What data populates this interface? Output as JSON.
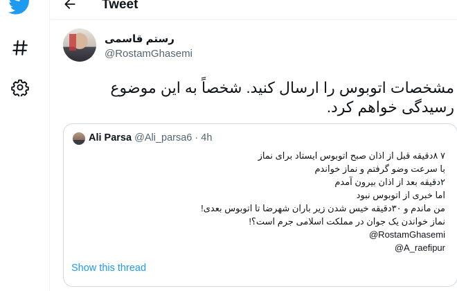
{
  "colors": {
    "brand": "#1d9bf0",
    "text": "#0f1419",
    "secondary": "#536471",
    "border": "#cfd9de"
  },
  "nav": {
    "icons": [
      "twitter-bird-icon",
      "hashtag-icon",
      "gear-icon"
    ]
  },
  "header": {
    "title": "Tweet"
  },
  "tweet": {
    "author_name": "رستم قاسمی",
    "author_handle": "@RostamGhasemi",
    "text": "مشخصات اتوبوس را ارسال کنید. شخصاً به این موضوع رسیدگی خواهم کرد."
  },
  "quoted_tweet": {
    "author_name": "Ali Parsa",
    "author_handle": "@Ali_parsa6",
    "separator": "·",
    "time": "4h",
    "lines": [
      "۷ ۸دقیقه قبل از اذان صبح اتوبوس ایستاد برای نماز",
      "با سرعت وضو گرفتم و نماز خواندم",
      "۲دقیقه بعد از اذان بیرون آمدم",
      "اما خبری از اتوبوس نبود",
      "من ماندم و ۳۰دقیقه خیس شدن زیر باران شهرضا تا اتوبوس بعدی!",
      "نماز خواندن یک جوان در مملکت اسلامی جرم است؟!",
      "@RostamGhasemi",
      "@A_raefipur"
    ],
    "show_thread_label": "Show this thread"
  }
}
